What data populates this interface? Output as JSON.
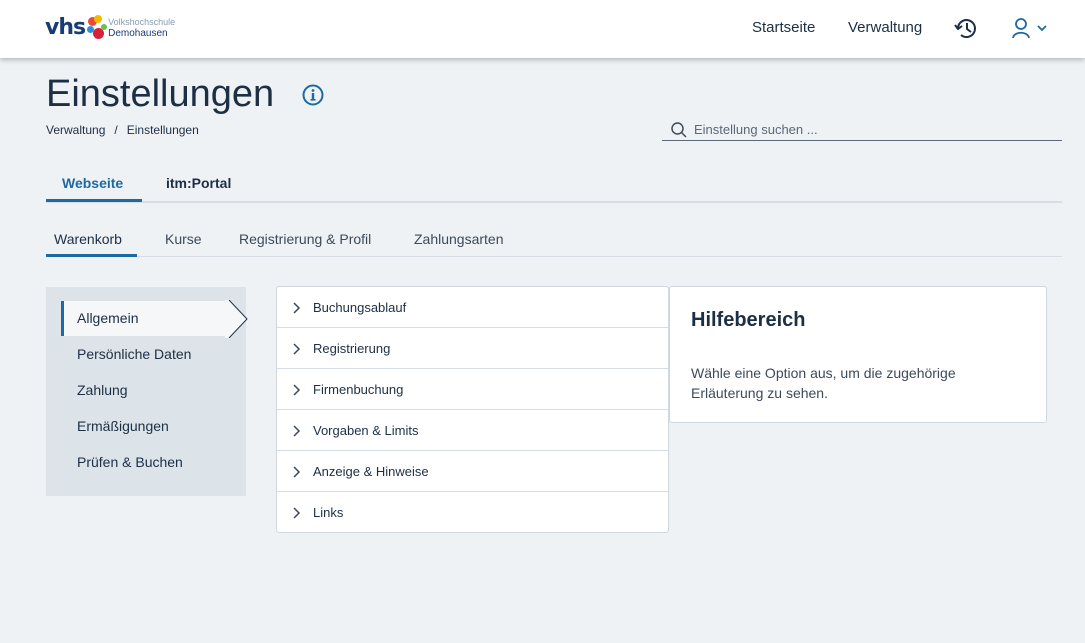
{
  "header": {
    "logo": {
      "brand": "vhs",
      "line1": "Volkshochschule",
      "line2": "Demohausen"
    },
    "nav": [
      {
        "label": "Startseite"
      },
      {
        "label": "Verwaltung"
      }
    ],
    "icons": {
      "history": "history-icon",
      "user": "user-icon",
      "chevron": "chevron-down-icon"
    }
  },
  "page": {
    "title": "Einstellungen",
    "breadcrumb": [
      "Verwaltung",
      "Einstellungen"
    ],
    "breadcrumb_separator": "/"
  },
  "search": {
    "placeholder": "Einstellung suchen ...",
    "value": ""
  },
  "tabs": [
    {
      "label": "Webseite",
      "active": true
    },
    {
      "label": "itm:Portal",
      "active": false
    }
  ],
  "subtabs": [
    {
      "label": "Warenkorb",
      "active": true
    },
    {
      "label": "Kurse",
      "active": false
    },
    {
      "label": "Registrierung & Profil",
      "active": false
    },
    {
      "label": "Zahlungsarten",
      "active": false
    }
  ],
  "sidebar": {
    "items": [
      {
        "label": "Allgemein",
        "active": true
      },
      {
        "label": "Persönliche Daten",
        "active": false
      },
      {
        "label": "Zahlung",
        "active": false
      },
      {
        "label": "Ermäßigungen",
        "active": false
      },
      {
        "label": "Prüfen & Buchen",
        "active": false
      }
    ]
  },
  "settings_list": [
    {
      "label": "Buchungsablauf"
    },
    {
      "label": "Registrierung"
    },
    {
      "label": "Firmenbuchung"
    },
    {
      "label": "Vorgaben & Limits"
    },
    {
      "label": "Anzeige & Hinweise"
    },
    {
      "label": "Links"
    }
  ],
  "help": {
    "title": "Hilfebereich",
    "text": "Wähle eine Option aus, um die zugehörige Erläuterung zu sehen."
  },
  "colors": {
    "accent": "#1e6aa0",
    "text": "#1d2f45",
    "background": "#eef2f5"
  }
}
